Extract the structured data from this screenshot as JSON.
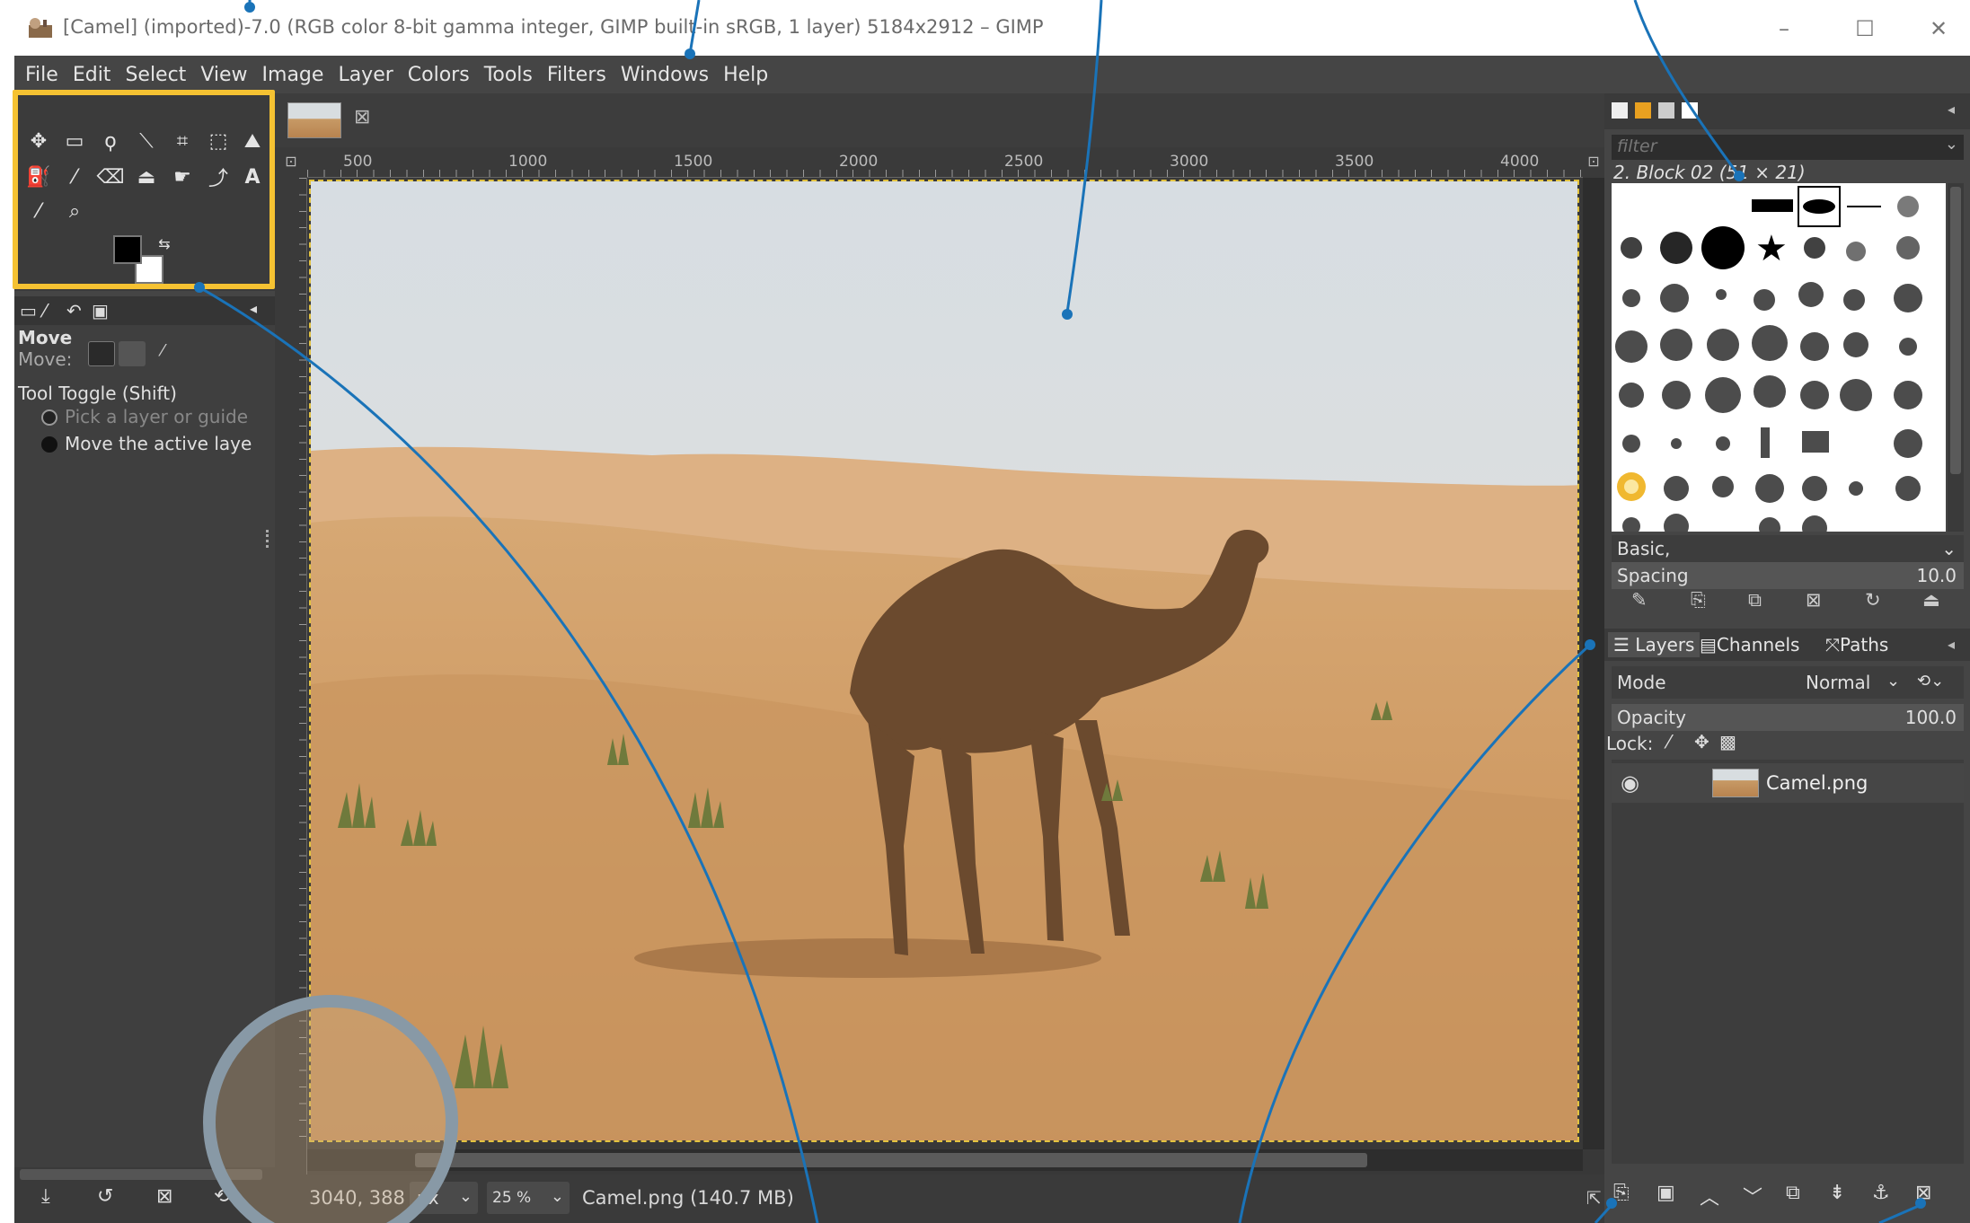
{
  "window": {
    "title": "[Camel] (imported)-7.0 (RGB color 8-bit gamma integer, GIMP built-in sRGB, 1 layer) 5184x2912 – GIMP",
    "minimize": "–",
    "maximize": "☐",
    "close": "✕"
  },
  "menu": [
    "File",
    "Edit",
    "Select",
    "View",
    "Image",
    "Layer",
    "Colors",
    "Tools",
    "Filters",
    "Windows",
    "Help"
  ],
  "toolbox": {
    "icons": [
      "move-tool-icon",
      "rect-select-icon",
      "free-select-icon",
      "fuzzy-select-icon",
      "crop-icon",
      "unified-transform-icon",
      "warp-transform-icon",
      "bucket-fill-icon",
      "paintbrush-icon",
      "eraser-icon",
      "clone-icon",
      "smudge-icon",
      "paths-icon",
      "text-icon",
      "color-picker-icon",
      "zoom-icon"
    ],
    "fg_color": "#000000",
    "bg_color": "#ffffff",
    "highlight_color": "#f5c232"
  },
  "tool_options": {
    "title": "Move",
    "move_label": "Move:",
    "toggle_label": "Tool Toggle  (Shift)",
    "option1": "Pick a layer or guide",
    "option2": "Move the active laye"
  },
  "image_tab": {
    "close": "⊠"
  },
  "ruler": {
    "h_ticks": [
      "500",
      "1000",
      "1500",
      "2000",
      "2500",
      "3000",
      "3500",
      "4000"
    ]
  },
  "status": {
    "coords": "3040, 388",
    "unit": "px",
    "zoom": "25 %",
    "info": "Camel.png (140.7 MB)"
  },
  "brushes": {
    "filter_placeholder": "filter",
    "current": "2. Block 02 (51 × 21)",
    "set": "Basic,",
    "spacing_label": "Spacing",
    "spacing_value": "10.0"
  },
  "layers": {
    "tabs": [
      "Layers",
      "Channels",
      "Paths"
    ],
    "mode_label": "Mode",
    "mode_value": "Normal",
    "opacity_label": "Opacity",
    "opacity_value": "100.0",
    "lock_label": "Lock:",
    "layer_name": "Camel.png"
  },
  "colors": {
    "accent": "#f5c232",
    "callout": "#1a73b8",
    "panel": "#454545"
  }
}
